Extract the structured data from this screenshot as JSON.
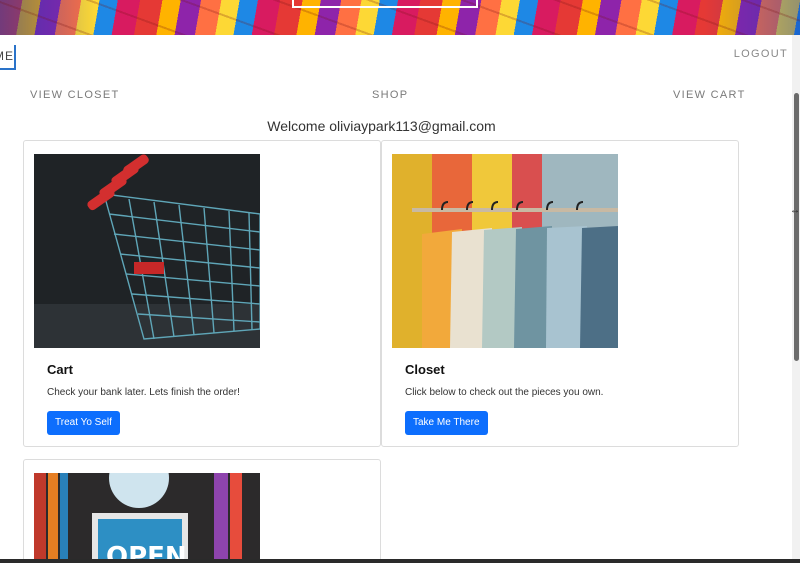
{
  "nav": {
    "home_label": "HOME",
    "logout_label": "LOGOUT"
  },
  "links": {
    "view_closet": "VIEW CLOSET",
    "shop": "SHOP",
    "view_cart": "VIEW CART"
  },
  "welcome": "Welcome oliviaypark113@gmail.com",
  "cards": [
    {
      "title": "Cart",
      "text": "Check your bank later. Lets finish the order!",
      "button": "Treat Yo Self",
      "image": "shopping-carts-photo"
    },
    {
      "title": "Closet",
      "text": "Click below to check out the pieces you own.",
      "button": "Take Me There",
      "image": "clothes-rack-photo"
    },
    {
      "image": "open-sign-photo"
    }
  ],
  "colors": {
    "button": "#0d6efd",
    "nav_accent": "#2a73c9"
  }
}
